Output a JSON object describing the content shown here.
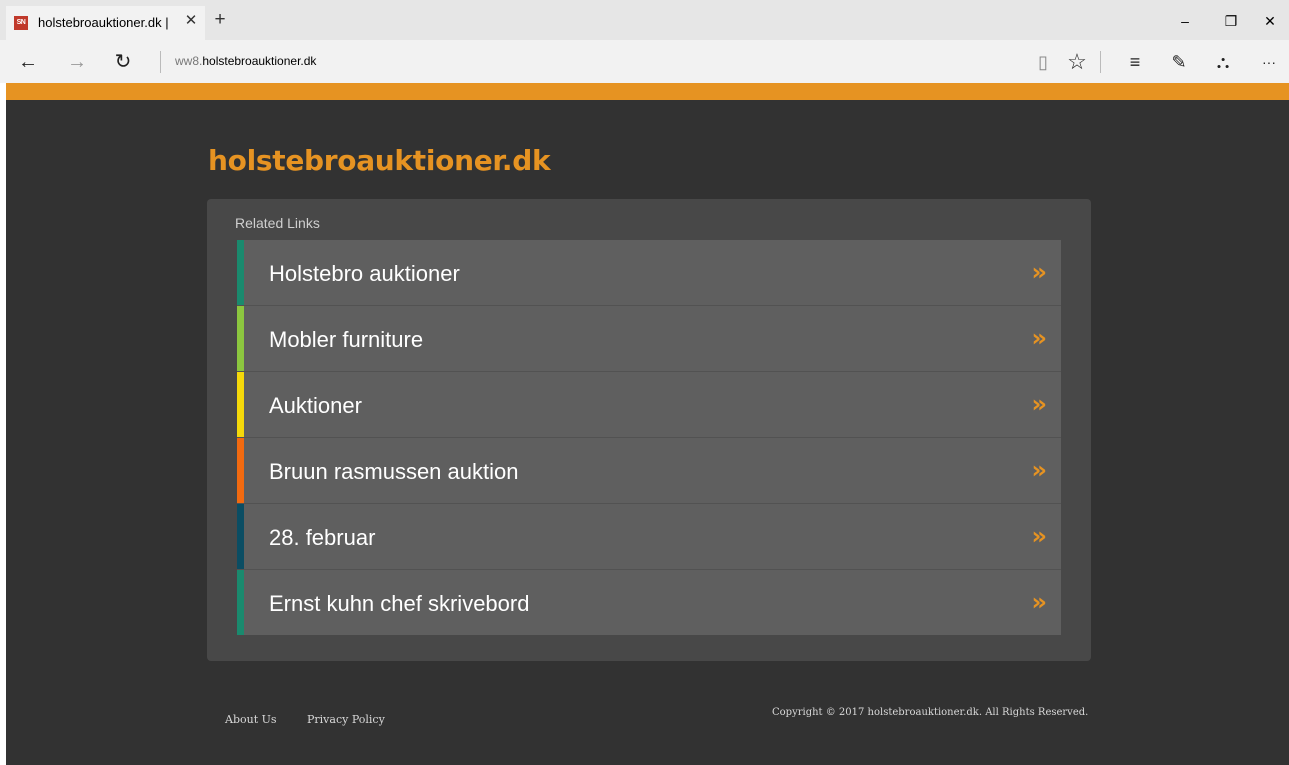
{
  "browser": {
    "tab_title": "holstebroauktioner.dk |",
    "favicon_text": "SN",
    "close_tab": "✕",
    "new_tab": "+",
    "url_sub": "ww8.",
    "url_domain": "holstebroauktioner.dk",
    "window_controls": {
      "minimize": "–",
      "restore": "❐",
      "close": "✕"
    },
    "nav": {
      "back": "←",
      "forward": "→",
      "refresh": "↻"
    },
    "tools": {
      "reading_view": "▯",
      "favorite": "☆",
      "hub": "≡",
      "web_note": "✎",
      "share": "⛬",
      "more": "···"
    }
  },
  "site": {
    "title": "holstebroauktioner.dk",
    "accent_color": "#e69322",
    "related_heading": "Related Links",
    "arrow_glyph": "»",
    "links": [
      {
        "label": "Holstebro auktioner",
        "color": "#1a8a6e"
      },
      {
        "label": "Mobler furniture",
        "color": "#8cc63f"
      },
      {
        "label": "Auktioner",
        "color": "#f5d90a"
      },
      {
        "label": "Bruun rasmussen auktion",
        "color": "#f26a10"
      },
      {
        "label": "28. februar",
        "color": "#0b4d63"
      },
      {
        "label": "Ernst kuhn chef skrivebord",
        "color": "#1a8a6e"
      }
    ]
  },
  "footer": {
    "about": "About Us",
    "privacy": "Privacy Policy",
    "copyright": "Copyright © 2017 holstebroauktioner.dk. All Rights Reserved."
  }
}
